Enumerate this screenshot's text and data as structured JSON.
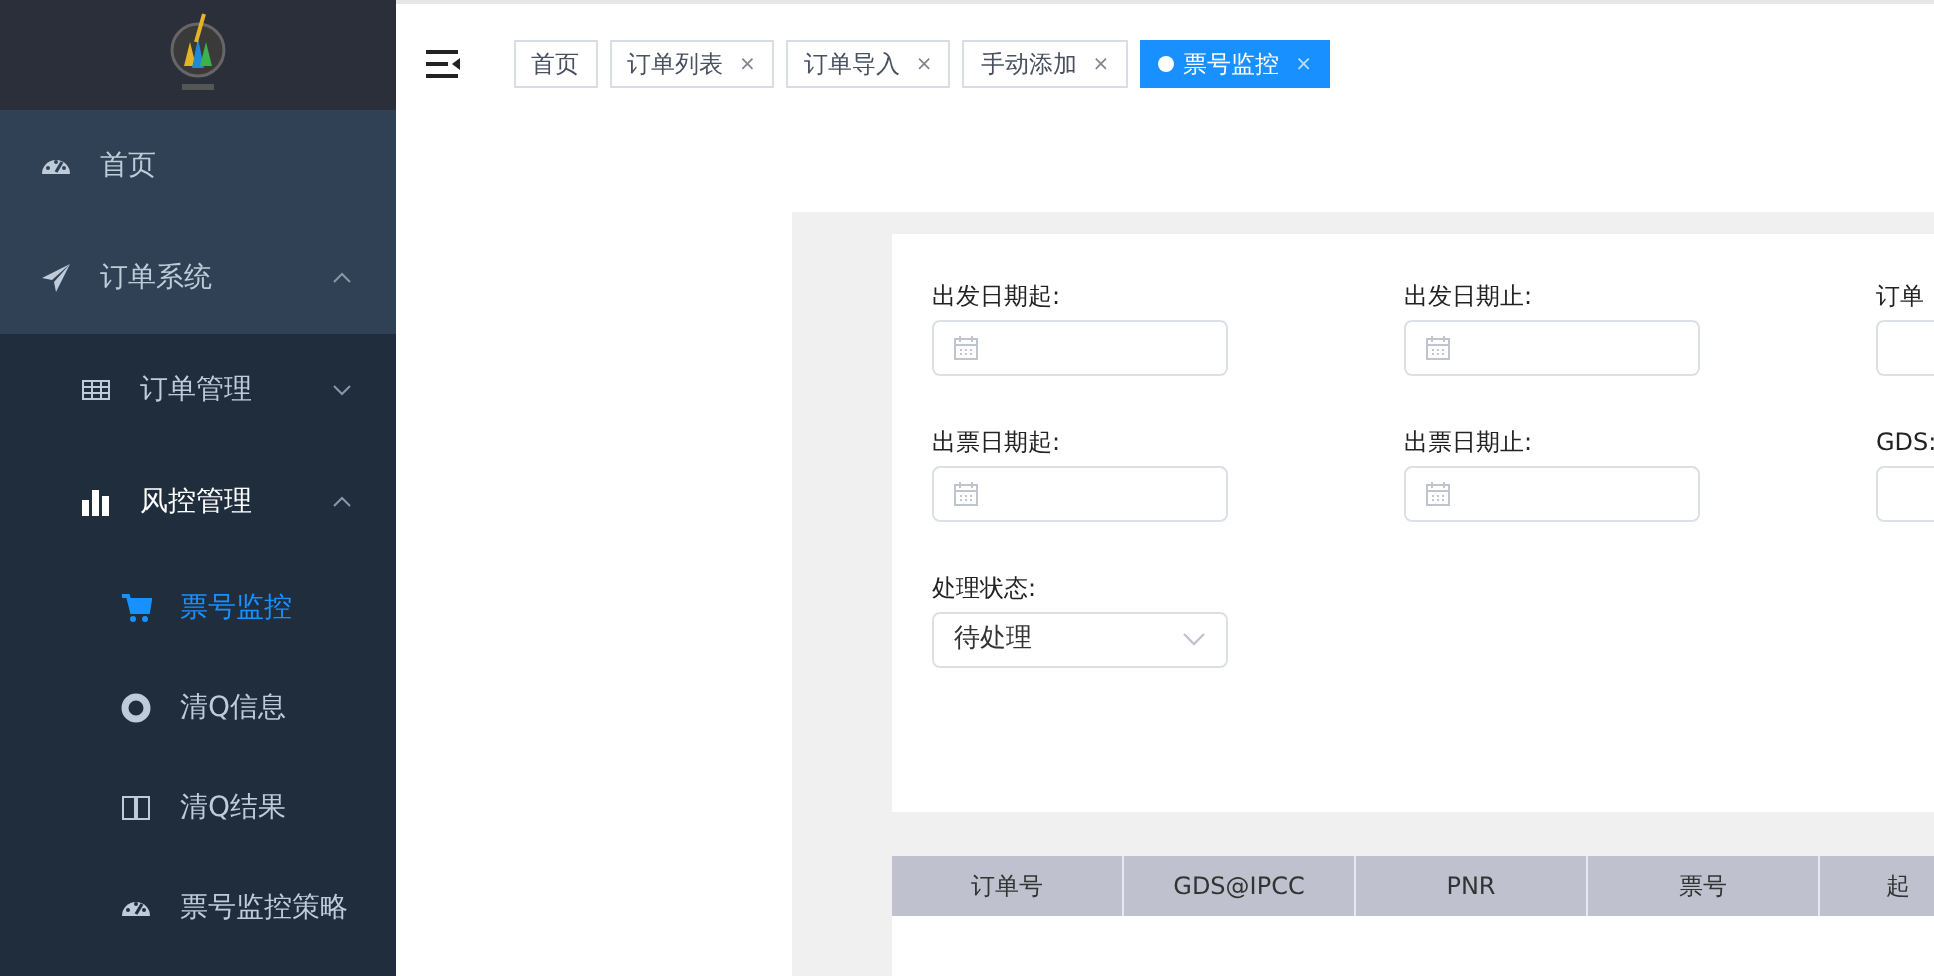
{
  "sidebar": {
    "items": [
      {
        "label": "首页",
        "selected": false
      },
      {
        "label": "订单系统",
        "expanded": true,
        "selected": false,
        "children": [
          {
            "label": "订单管理",
            "expanded": false,
            "selected": false
          },
          {
            "label": "风控管理",
            "expanded": true,
            "selected": false,
            "children": [
              {
                "label": "票号监控",
                "selected": true
              },
              {
                "label": "清Q信息",
                "selected": false
              },
              {
                "label": "清Q结果",
                "selected": false
              },
              {
                "label": "票号监控策略",
                "selected": false
              }
            ]
          }
        ]
      }
    ]
  },
  "tabs": [
    {
      "label": "首页",
      "closable": false,
      "selected": false
    },
    {
      "label": "订单列表",
      "closable": true,
      "selected": false
    },
    {
      "label": "订单导入",
      "closable": true,
      "selected": false
    },
    {
      "label": "手动添加",
      "closable": true,
      "selected": false
    },
    {
      "label": "票号监控",
      "closable": true,
      "selected": true
    }
  ],
  "tab_close": "×",
  "filters": [
    {
      "label": "出发日期起:",
      "kind": "date"
    },
    {
      "label": "出发日期止:",
      "kind": "date"
    },
    {
      "label": "订单",
      "kind": "text"
    },
    {
      "label": "出票日期起:",
      "kind": "date"
    },
    {
      "label": "出票日期止:",
      "kind": "date"
    },
    {
      "label": "GDS:",
      "kind": "text"
    },
    {
      "label": "处理状态:",
      "kind": "select",
      "value": "待处理"
    }
  ],
  "table": {
    "columns": [
      "订单号",
      "GDS@IPCC",
      "PNR",
      "票号",
      "起"
    ]
  }
}
